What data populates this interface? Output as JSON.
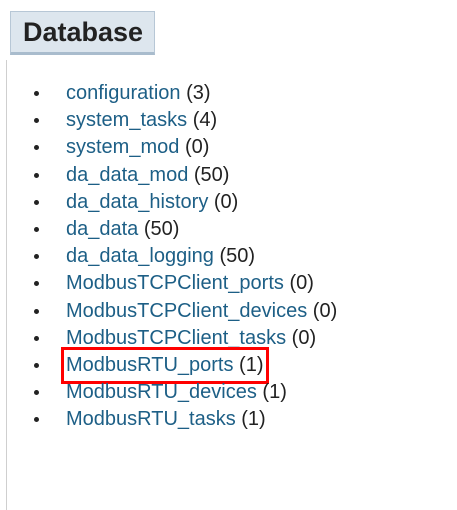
{
  "header": {
    "title": "Database"
  },
  "tables": [
    {
      "name": "configuration",
      "count": "(3)",
      "highlighted": false
    },
    {
      "name": "system_tasks",
      "count": "(4)",
      "highlighted": false
    },
    {
      "name": "system_mod",
      "count": "(0)",
      "highlighted": false
    },
    {
      "name": "da_data_mod",
      "count": "(50)",
      "highlighted": false
    },
    {
      "name": "da_data_history",
      "count": "(0)",
      "highlighted": false
    },
    {
      "name": "da_data",
      "count": "(50)",
      "highlighted": false
    },
    {
      "name": "da_data_logging",
      "count": "(50)",
      "highlighted": false
    },
    {
      "name": "ModbusTCPClient_ports",
      "count": "(0)",
      "highlighted": false
    },
    {
      "name": "ModbusTCPClient_devices",
      "count": "(0)",
      "highlighted": false
    },
    {
      "name": "ModbusTCPClient_tasks",
      "count": "(0)",
      "highlighted": false
    },
    {
      "name": "ModbusRTU_ports",
      "count": "(1)",
      "highlighted": true
    },
    {
      "name": "ModbusRTU_devices",
      "count": "(1)",
      "highlighted": false
    },
    {
      "name": "ModbusRTU_tasks",
      "count": "(1)",
      "highlighted": false
    }
  ],
  "colors": {
    "link": "#1d5f86",
    "heading_background": "#dde6ee",
    "highlight_border": "#ff0000"
  }
}
